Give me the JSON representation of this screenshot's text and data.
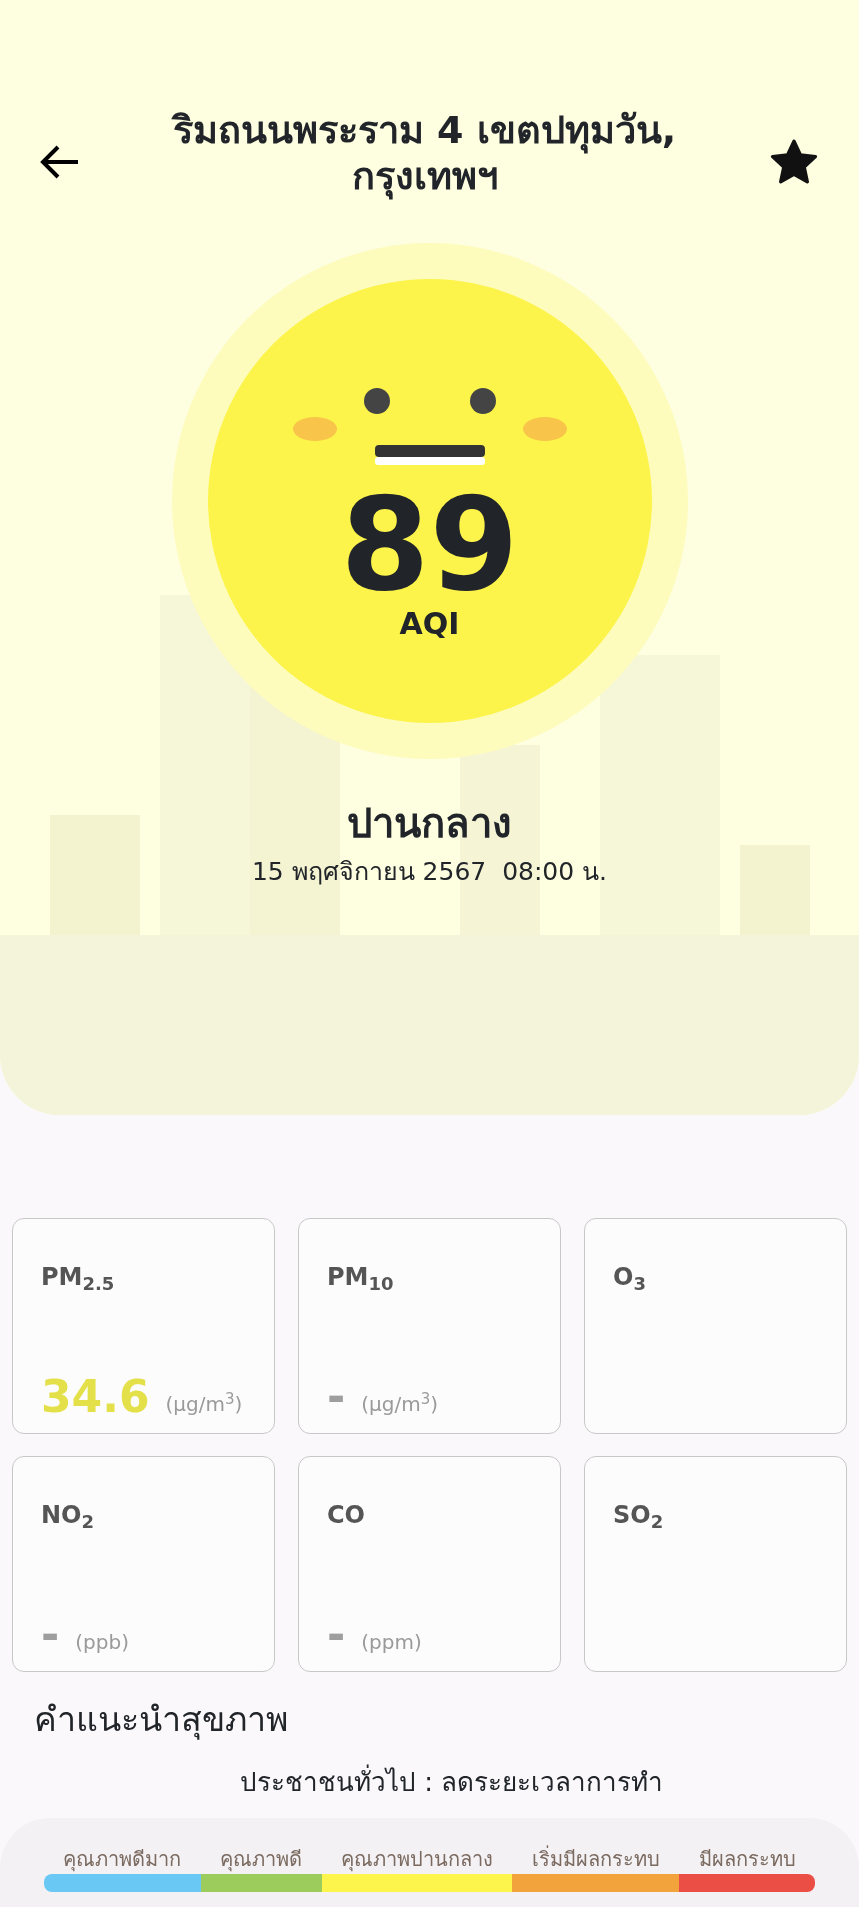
{
  "header": {
    "title": "ริมถนนพระราม 4 เขตปทุมวัน, กรุงเทพฯ",
    "favorite": true
  },
  "aqi": {
    "value": "89",
    "unit": "AQI"
  },
  "status": "ปานกลาง",
  "updated": "15 พฤศจิกายน 2567  08:00 น.",
  "pollutants": [
    {
      "name": "PM$_{2.5}$",
      "value": "34.6",
      "unit": "(µg/m$^{3}$)",
      "color": "#e3e04a"
    },
    {
      "name": "PM$_{10}$",
      "value": "-",
      "unit": "(µg/m$^{3}$)",
      "color": "#9e9e9e"
    },
    {
      "name": "O$_{3}$"
    },
    {
      "name": "NO$_{2}$",
      "value": "-",
      "unit": "(ppb)",
      "color": "#9e9e9e"
    },
    {
      "name": "CO",
      "value": "-",
      "unit": "(ppm)",
      "color": "#9e9e9e"
    },
    {
      "name": "SO$_{2}$"
    }
  ],
  "advice": {
    "title": "คำแนะนำสุขภาพ",
    "text": "ประชาชนทั่วไป : ลดระยะเวลาการทำ"
  },
  "legend": [
    {
      "label": "คุณภาพดีมาก",
      "color": "#6ac8f5"
    },
    {
      "label": "คุณภาพดี",
      "color": "#9ccc5c"
    },
    {
      "label": "คุณภาพปานกลาง",
      "color": "#fdf54b"
    },
    {
      "label": "เริ่มมีผลกระทบ",
      "color": "#f3a33c"
    },
    {
      "label": "มีผลกระทบ",
      "color": "#ea4e45"
    }
  ]
}
